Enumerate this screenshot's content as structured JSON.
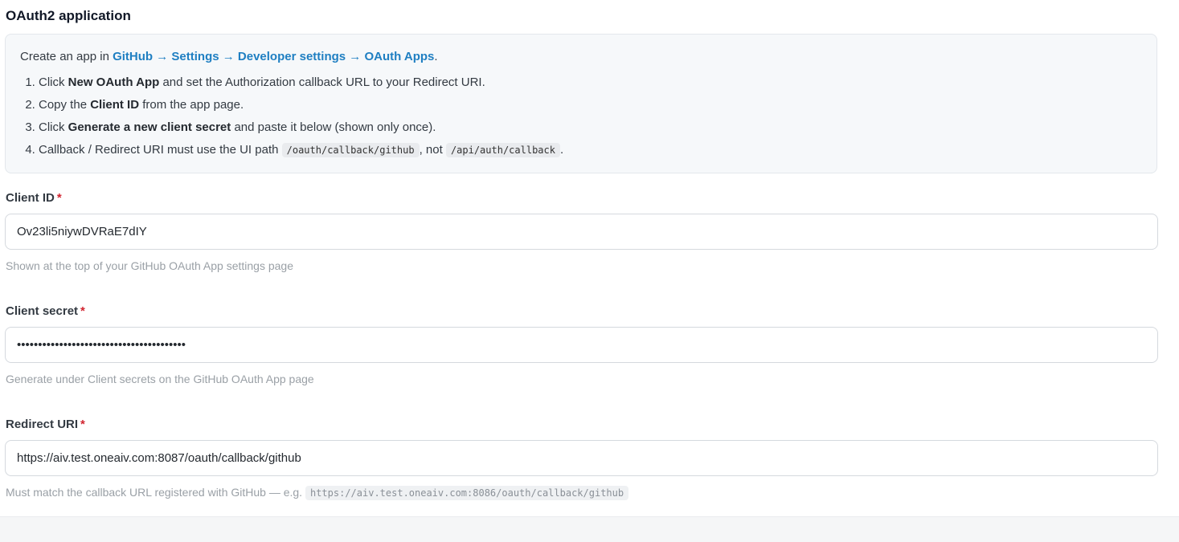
{
  "section": {
    "title": "OAuth2 application"
  },
  "info": {
    "intro_prefix": "Create an app in ",
    "intro_link": "GitHub → Settings → Developer settings → OAuth Apps",
    "intro_suffix": ".",
    "steps": [
      {
        "pre": "Click ",
        "bold": "New OAuth App",
        "post": " and set the Authorization callback URL to your Redirect URI."
      },
      {
        "pre": "Copy the ",
        "bold": "Client ID",
        "post": " from the app page."
      },
      {
        "pre": "Click ",
        "bold": "Generate a new client secret",
        "post": " and paste it below (shown only once)."
      },
      {
        "pre": "Callback / Redirect URI must use the UI path ",
        "code1": "/oauth/callback/github",
        "mid": ", not ",
        "code2": "/api/auth/callback",
        "post": "."
      }
    ]
  },
  "fields": {
    "client_id": {
      "label": "Client ID",
      "required_mark": "*",
      "value": "Ov23li5niywDVRaE7dIY",
      "hint": "Shown at the top of your GitHub OAuth App settings page"
    },
    "client_secret": {
      "label": "Client secret",
      "required_mark": "*",
      "value": "••••••••••••••••••••••••••••••••••••••••",
      "hint": "Generate under Client secrets on the GitHub OAuth App page"
    },
    "redirect_uri": {
      "label": "Redirect URI",
      "required_mark": "*",
      "value": "https://aiv.test.oneaiv.com:8087/oauth/callback/github",
      "hint_prefix": "Must match the callback URL registered with GitHub — e.g. ",
      "hint_code": "https://aiv.test.oneaiv.com:8086/oauth/callback/github"
    }
  },
  "colors": {
    "link": "#1f7fc2",
    "required": "#d1242f",
    "hint": "#9aa0a6",
    "box_bg": "#f6f8fa"
  }
}
